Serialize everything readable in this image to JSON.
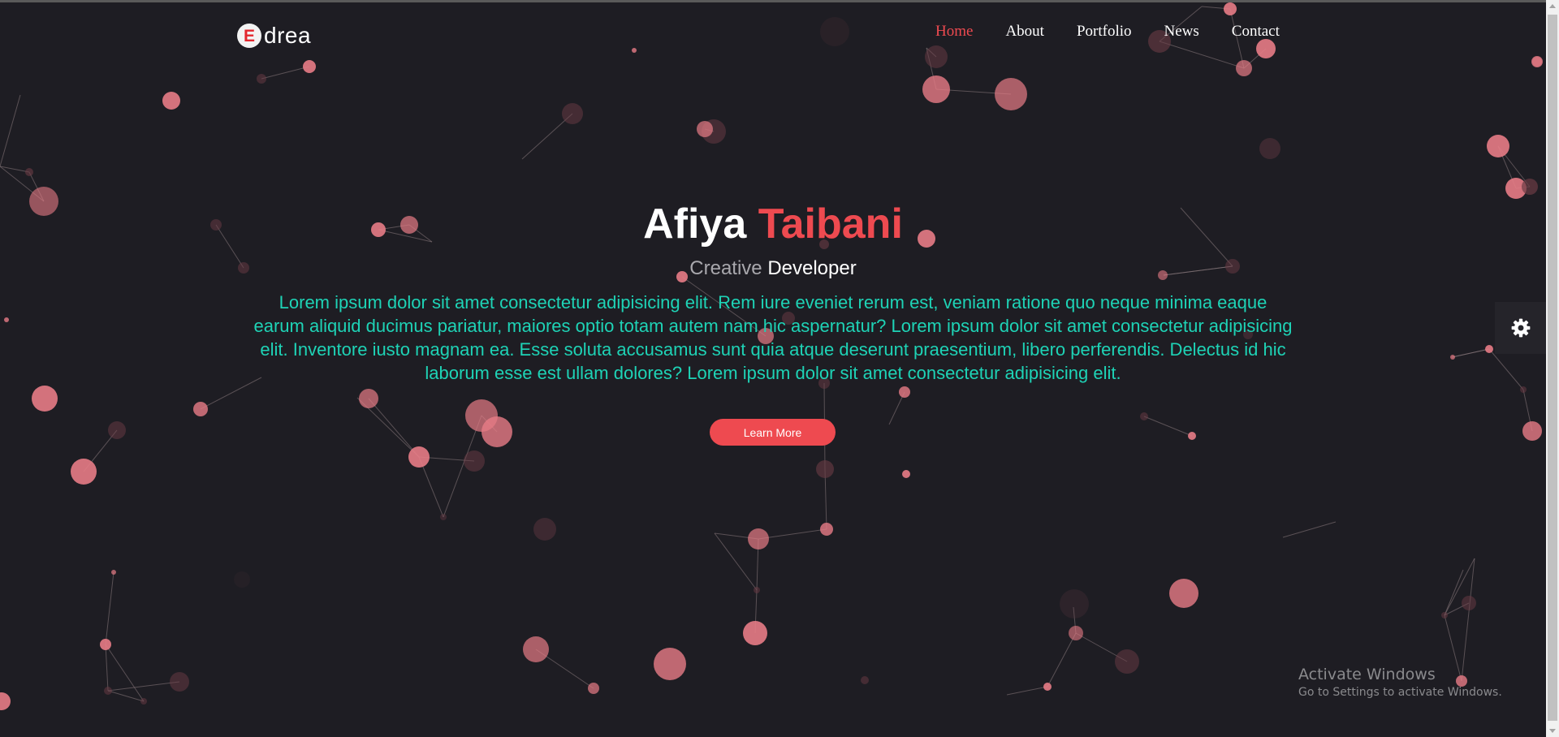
{
  "brand": {
    "logo_letter": "E",
    "logo_text": "drea"
  },
  "nav": {
    "items": [
      {
        "label": "Home",
        "active": true
      },
      {
        "label": "About",
        "active": false
      },
      {
        "label": "Portfolio",
        "active": false
      },
      {
        "label": "News",
        "active": false
      },
      {
        "label": "Contact",
        "active": false
      }
    ]
  },
  "hero": {
    "first_name": "Afiya",
    "last_name": "Taibani",
    "subtitle_muted": "Creative",
    "subtitle_strong": "Developer",
    "description": "Lorem ipsum dolor sit amet consectetur adipisicing elit. Rem iure eveniet rerum est, veniam ratione quo neque minima eaque earum aliquid ducimus pariatur, maiores optio totam autem nam hic aspernatur? Lorem ipsum dolor sit amet consectetur adipisicing elit. Inventore iusto magnam ea. Esse soluta accusamus sunt quia atque deserunt praesentium, libero perferendis. Delectus id hic laborum esse est ullam dolores? Lorem ipsum dolor sit amet consectetur adipisicing elit.",
    "button_label": "Learn More"
  },
  "settings": {
    "icon": "gear-icon"
  },
  "watermark": {
    "title": "Activate Windows",
    "subtitle": "Go to Settings to activate Windows."
  },
  "colors": {
    "background": "#1e1d23",
    "accent": "#ee4a50",
    "description": "#1ed3b6",
    "particle": "#e77c86",
    "particle_dim": "#6b3c45"
  }
}
